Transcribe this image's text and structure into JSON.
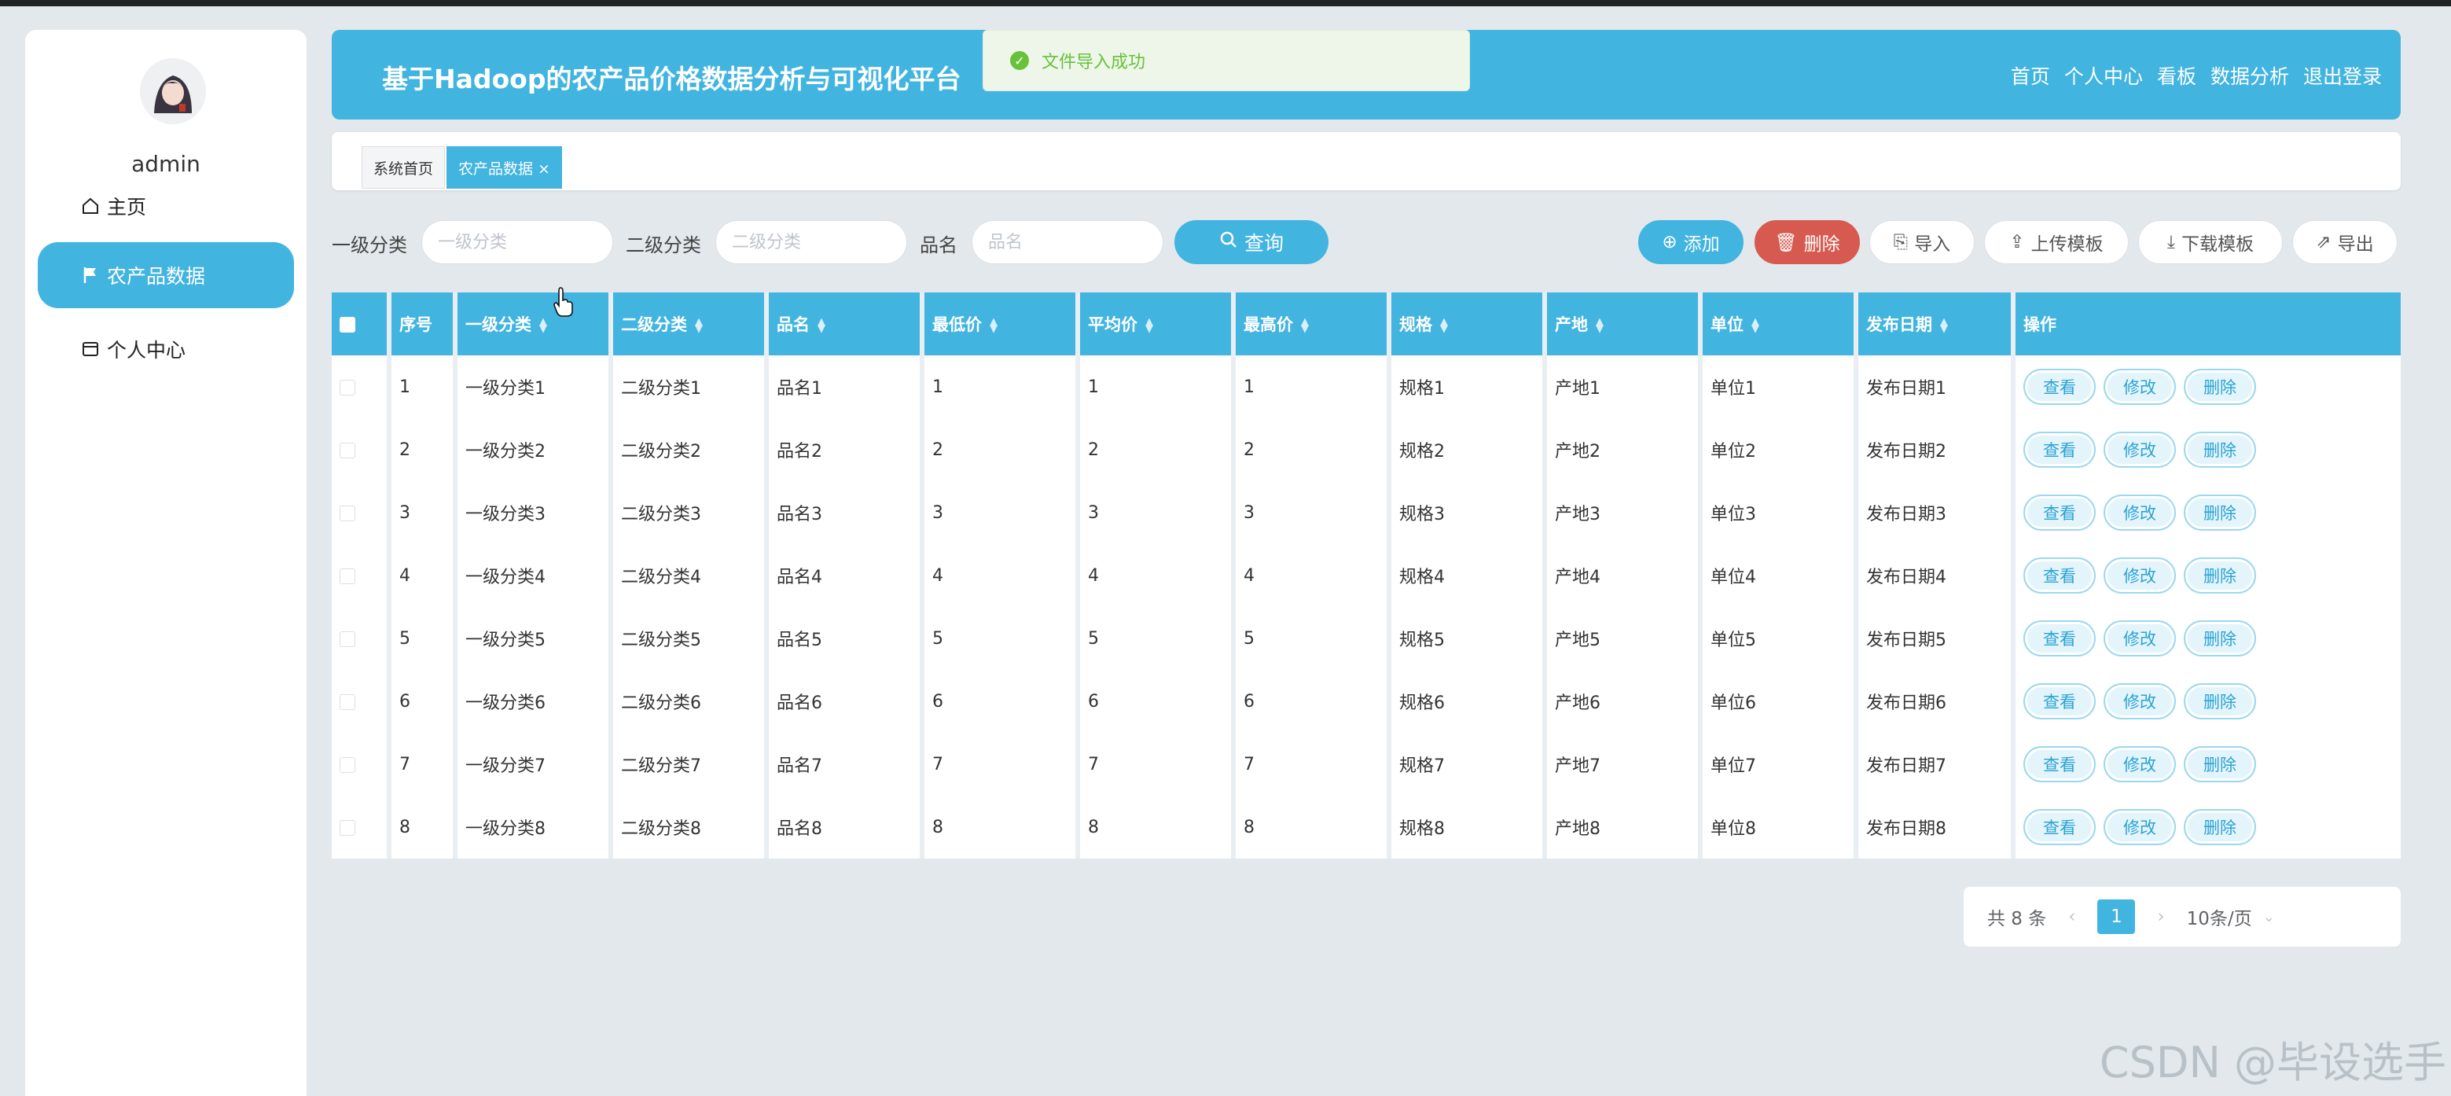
{
  "sidebar": {
    "username": "admin",
    "items": [
      {
        "label": "主页",
        "icon": "home-icon"
      },
      {
        "label": "农产品数据",
        "icon": "flag-icon"
      },
      {
        "label": "个人中心",
        "icon": "card-icon"
      }
    ]
  },
  "header": {
    "title": "基于Hadoop的农产品价格数据分析与可视化平台",
    "nav": [
      "首页",
      "个人中心",
      "看板",
      "数据分析",
      "退出登录"
    ]
  },
  "toast": {
    "message": "文件导入成功"
  },
  "tags": [
    "系统首页",
    "农产品数据 ×"
  ],
  "search": {
    "fields": [
      {
        "label": "一级分类",
        "placeholder": "一级分类"
      },
      {
        "label": "二级分类",
        "placeholder": "二级分类"
      },
      {
        "label": "品名",
        "placeholder": "品名"
      }
    ],
    "query_label": "查询"
  },
  "actions": {
    "add": "添加",
    "delete": "删除",
    "import": "导入",
    "upload_template": "上传模板",
    "download_template": "下载模板",
    "export": "导出"
  },
  "table": {
    "columns": [
      "序号",
      "一级分类",
      "二级分类",
      "品名",
      "最低价",
      "平均价",
      "最高价",
      "规格",
      "产地",
      "单位",
      "发布日期",
      "操作"
    ],
    "rows": [
      [
        "1",
        "一级分类1",
        "二级分类1",
        "品名1",
        "1",
        "1",
        "1",
        "规格1",
        "产地1",
        "单位1",
        "发布日期1"
      ],
      [
        "2",
        "一级分类2",
        "二级分类2",
        "品名2",
        "2",
        "2",
        "2",
        "规格2",
        "产地2",
        "单位2",
        "发布日期2"
      ],
      [
        "3",
        "一级分类3",
        "二级分类3",
        "品名3",
        "3",
        "3",
        "3",
        "规格3",
        "产地3",
        "单位3",
        "发布日期3"
      ],
      [
        "4",
        "一级分类4",
        "二级分类4",
        "品名4",
        "4",
        "4",
        "4",
        "规格4",
        "产地4",
        "单位4",
        "发布日期4"
      ],
      [
        "5",
        "一级分类5",
        "二级分类5",
        "品名5",
        "5",
        "5",
        "5",
        "规格5",
        "产地5",
        "单位5",
        "发布日期5"
      ],
      [
        "6",
        "一级分类6",
        "二级分类6",
        "品名6",
        "6",
        "6",
        "6",
        "规格6",
        "产地6",
        "单位6",
        "发布日期6"
      ],
      [
        "7",
        "一级分类7",
        "二级分类7",
        "品名7",
        "7",
        "7",
        "7",
        "规格7",
        "产地7",
        "单位7",
        "发布日期7"
      ],
      [
        "8",
        "一级分类8",
        "二级分类8",
        "品名8",
        "8",
        "8",
        "8",
        "规格8",
        "产地8",
        "单位8",
        "发布日期8"
      ]
    ],
    "row_actions": [
      "查看",
      "修改",
      "删除"
    ]
  },
  "pagination": {
    "total": "共 8 条",
    "current": "1",
    "page_size": "10条/页"
  },
  "watermark": "CSDN @毕设选手",
  "colors": {
    "primary": "#42b4e0",
    "danger": "#d65a4f",
    "success": "#67c23a",
    "background": "#e2e8eb"
  }
}
